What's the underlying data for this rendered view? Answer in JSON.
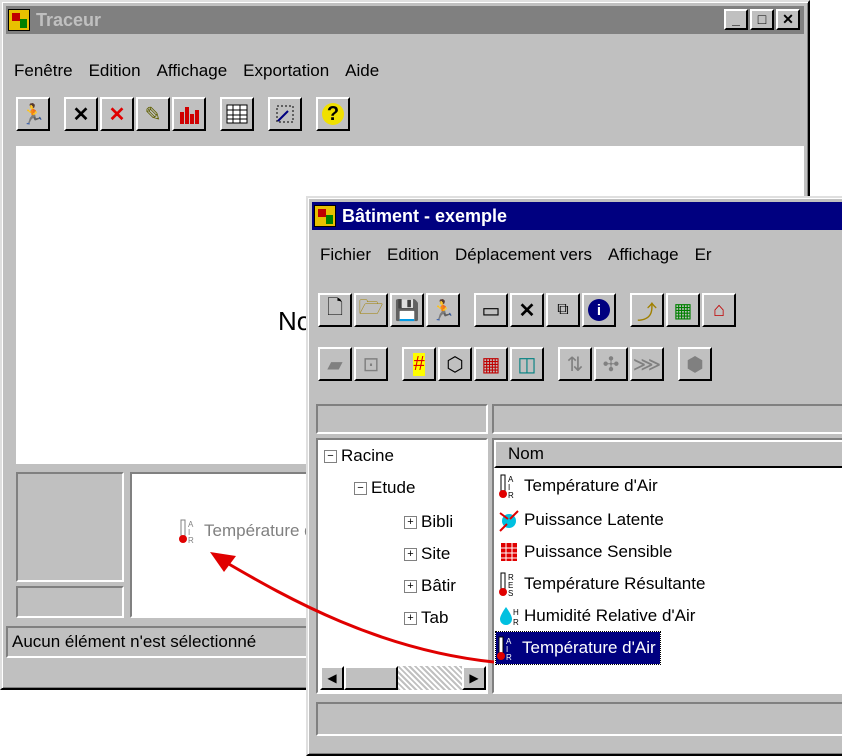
{
  "traceur": {
    "title": "Traceur",
    "menu": [
      "Fenêtre",
      "Edition",
      "Affichage",
      "Exportation",
      "Aide"
    ],
    "tool_icons": [
      "exit-icon",
      "delete-icon",
      "delete-red-icon",
      "edit-icon",
      "bar-chart-icon",
      "table-icon",
      "zoom-icon",
      "help-icon"
    ],
    "canvas_partial_text": "No",
    "dropped_item_label": "Température d'Air",
    "status_text": "Aucun élément n'est sélectionné"
  },
  "batiment": {
    "title": "Bâtiment - exemple",
    "menu": [
      "Fichier",
      "Edition",
      "Déplacement vers",
      "Affichage",
      "Er"
    ],
    "toolbar1_icons": [
      "new-icon",
      "open-icon",
      "save-icon",
      "exit-icon",
      "new-object-icon",
      "delete-icon",
      "copy-icon",
      "info-icon",
      "up-folder-icon",
      "building-icon",
      "house-icon"
    ],
    "toolbar2_icons": [
      "wall-icon",
      "floor-icon",
      "grid-icon",
      "cube-icon",
      "brick-icon",
      "door-icon",
      "move-icon",
      "move2-icon",
      "move3-icon",
      "node-icon"
    ],
    "tree": [
      {
        "label": "Racine",
        "sign": "−",
        "level": 0
      },
      {
        "label": "Etude",
        "sign": "−",
        "level": 1
      },
      {
        "label": "Bibli",
        "sign": "+",
        "level": 2
      },
      {
        "label": "Site",
        "sign": "+",
        "level": 2
      },
      {
        "label": "Bâtir",
        "sign": "+",
        "level": 2
      },
      {
        "label": "Tab",
        "sign": "+",
        "level": 2
      }
    ],
    "list_header": "Nom",
    "list_items": [
      "Température d'Air",
      "Puissance Latente",
      "Puissance Sensible",
      "Température Résultante",
      "Humidité Relative d'Air",
      "Température d'Air"
    ],
    "selected_index": 5
  },
  "colors": {
    "window_face": "#c0c0c0",
    "active_title": "#000080",
    "inactive_title": "#808080",
    "drag_arrow": "#e00000"
  }
}
